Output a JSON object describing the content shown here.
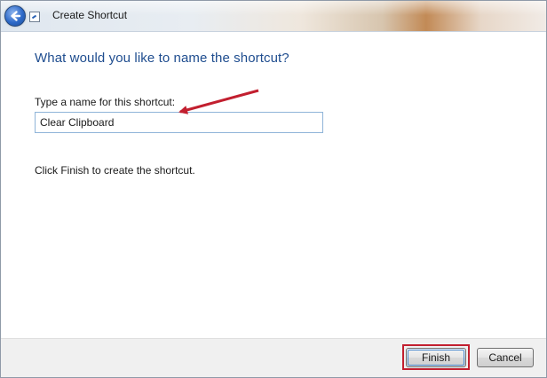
{
  "window": {
    "title": "Create Shortcut"
  },
  "titlebar": {
    "back_icon": "back-arrow-icon",
    "app_icon": "shortcut-icon"
  },
  "main": {
    "heading": "What would you like to name the shortcut?",
    "field_label": "Type a name for this shortcut:",
    "name_value": "Clear Clipboard",
    "hint": "Click Finish to create the shortcut."
  },
  "annotation": {
    "arrow_color": "#c21f2f",
    "highlight_color": "#c21f2f"
  },
  "footer": {
    "finish_label": "Finish",
    "cancel_label": "Cancel"
  }
}
